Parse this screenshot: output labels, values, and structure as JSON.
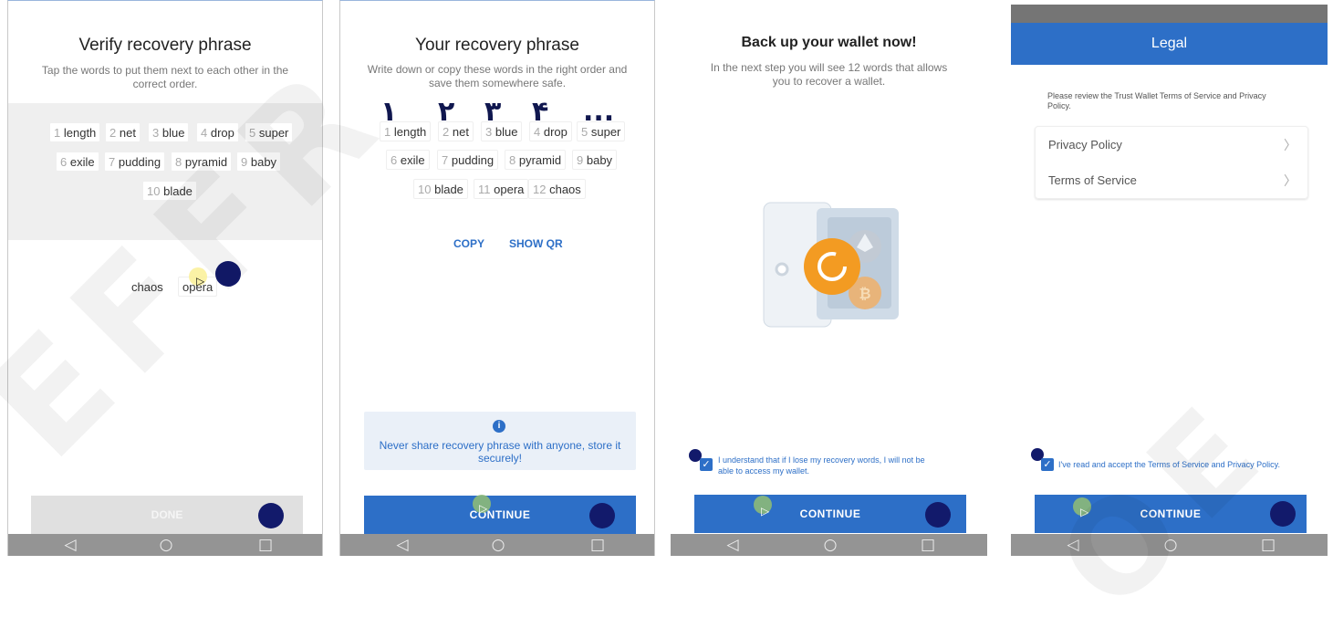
{
  "screens": {
    "verify": {
      "title": "Verify recovery phrase",
      "subtitle_line1": "Tap the words to put them next to each other in the",
      "subtitle_line2": "correct order.",
      "words": [
        {
          "n": "1",
          "w": "length"
        },
        {
          "n": "2",
          "w": "net"
        },
        {
          "n": "3",
          "w": "blue"
        },
        {
          "n": "4",
          "w": "drop"
        },
        {
          "n": "5",
          "w": "super"
        },
        {
          "n": "6",
          "w": "exile"
        },
        {
          "n": "7",
          "w": "pudding"
        },
        {
          "n": "8",
          "w": "pyramid"
        },
        {
          "n": "9",
          "w": "baby"
        },
        {
          "n": "10",
          "w": "blade"
        }
      ],
      "remaining": [
        "chaos",
        "opera"
      ],
      "done_label": "DONE"
    },
    "phrase": {
      "title": "Your recovery phrase",
      "subtitle_line1": "Write down or copy these words in the right order and",
      "subtitle_line2": "save them somewhere safe.",
      "annotations": [
        "۱",
        "۲",
        "۳",
        "۴",
        "..."
      ],
      "words": [
        {
          "n": "1",
          "w": "length"
        },
        {
          "n": "2",
          "w": "net"
        },
        {
          "n": "3",
          "w": "blue"
        },
        {
          "n": "4",
          "w": "drop"
        },
        {
          "n": "5",
          "w": "super"
        },
        {
          "n": "6",
          "w": "exile"
        },
        {
          "n": "7",
          "w": "pudding"
        },
        {
          "n": "8",
          "w": "pyramid"
        },
        {
          "n": "9",
          "w": "baby"
        },
        {
          "n": "10",
          "w": "blade"
        },
        {
          "n": "11",
          "w": "opera"
        },
        {
          "n": "12",
          "w": "chaos"
        }
      ],
      "copy_label": "COPY",
      "showqr_label": "SHOW QR",
      "warning_line1": "Never share recovery phrase with anyone, store it",
      "warning_line2": "securely!",
      "continue_label": "CONTINUE"
    },
    "backup": {
      "title": "Back up your wallet now!",
      "subtitle_line1": "In the next step you will see 12 words that allows",
      "subtitle_line2": "you to recover a wallet.",
      "checkbox_line1": "I understand that if I lose my recovery words, I will not be",
      "checkbox_line2": "able to access my wallet.",
      "continue_label": "CONTINUE"
    },
    "legal": {
      "header": "Legal",
      "intro_line1": "Please review the Trust Wallet Terms of Service and Privacy",
      "intro_line2": "Policy.",
      "items": [
        "Privacy Policy",
        "Terms of Service"
      ],
      "accept": "I've read and accept the Terms of Service and Privacy Policy.",
      "continue_label": "CONTINUE"
    }
  },
  "nav_icons": [
    "back-triangle-icon",
    "home-circle-icon",
    "recents-square-icon"
  ],
  "colors": {
    "accent": "#2d6fc7",
    "marker": "#121a6b",
    "navbar": "#949494"
  }
}
